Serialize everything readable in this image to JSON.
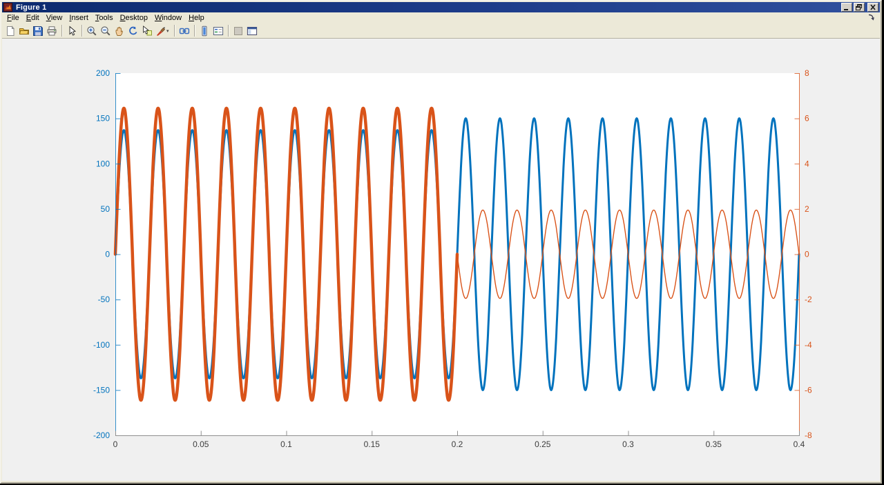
{
  "window": {
    "title": "Figure 1",
    "app_icon": "matlab-logo-icon",
    "controls": [
      {
        "name": "minimize-button",
        "icon": "minimize-icon"
      },
      {
        "name": "restore-button",
        "icon": "restore-icon"
      },
      {
        "name": "close-button",
        "icon": "close-icon"
      }
    ]
  },
  "menu_bar": {
    "items": [
      {
        "label": "File",
        "accelerator": "F"
      },
      {
        "label": "Edit",
        "accelerator": "E"
      },
      {
        "label": "View",
        "accelerator": "V"
      },
      {
        "label": "Insert",
        "accelerator": "I"
      },
      {
        "label": "Tools",
        "accelerator": "T"
      },
      {
        "label": "Desktop",
        "accelerator": "D"
      },
      {
        "label": "Window",
        "accelerator": "W"
      },
      {
        "label": "Help",
        "accelerator": "H"
      }
    ],
    "dock_arrow_icon": "dock-figure-arrow-icon"
  },
  "toolbar": {
    "buttons": [
      {
        "name": "new-figure-button",
        "icon": "new-document-icon",
        "group": 1
      },
      {
        "name": "open-file-button",
        "icon": "open-folder-icon",
        "group": 1
      },
      {
        "name": "save-figure-button",
        "icon": "save-icon",
        "group": 1
      },
      {
        "name": "print-figure-button",
        "icon": "print-icon",
        "group": 1
      },
      {
        "name": "edit-plot-button",
        "icon": "pointer-arrow-icon",
        "group": 2
      },
      {
        "name": "zoom-in-button",
        "icon": "zoom-in-icon",
        "group": 3
      },
      {
        "name": "zoom-out-button",
        "icon": "zoom-out-icon",
        "group": 3
      },
      {
        "name": "pan-button",
        "icon": "pan-hand-icon",
        "group": 3
      },
      {
        "name": "rotate-3d-button",
        "icon": "rotate-3d-icon",
        "group": 3
      },
      {
        "name": "data-cursor-button",
        "icon": "data-cursor-icon",
        "group": 3
      },
      {
        "name": "brush-data-button",
        "icon": "brush-icon",
        "group": 3,
        "has_dropdown": true
      },
      {
        "name": "link-plot-button",
        "icon": "link-plot-icon",
        "group": 4
      },
      {
        "name": "insert-colorbar-button",
        "icon": "colorbar-icon",
        "group": 5
      },
      {
        "name": "insert-legend-button",
        "icon": "legend-icon",
        "group": 5
      },
      {
        "name": "hide-plot-tools-button",
        "icon": "hide-plot-tools-icon",
        "group": 6
      },
      {
        "name": "show-plot-tools-button",
        "icon": "show-plot-tools-dock-icon",
        "group": 6
      }
    ]
  },
  "figure": {
    "background_color": "#f0f0f0"
  },
  "chart_data": {
    "type": "line",
    "title": "",
    "grid": false,
    "legend": null,
    "transition_time_s": 0.2,
    "x": {
      "label": "",
      "range": [
        0,
        0.4
      ],
      "ticks": [
        0,
        0.05,
        0.1,
        0.15,
        0.2,
        0.25,
        0.3,
        0.35,
        0.4
      ],
      "line_color": "#8f8f8f",
      "tick_label_color": "#3c3c3c"
    },
    "left_axis": {
      "range": [
        -200,
        200
      ],
      "ticks": [
        200,
        150,
        100,
        50,
        0,
        -50,
        -100,
        -150,
        -200
      ],
      "color": "#0072BD"
    },
    "right_axis": {
      "range": [
        -8,
        8
      ],
      "ticks": [
        8,
        6,
        4,
        2,
        0,
        -2,
        -4,
        -6,
        -8
      ],
      "color": "#D95319"
    },
    "series": [
      {
        "name": "blue-wave",
        "axis": "left",
        "color": "#0072BD",
        "waveform": "sine",
        "frequency_hz": 50,
        "segments": [
          {
            "t_start": 0.0,
            "t_end": 0.2,
            "amplitude": 137,
            "phase_deg": 0,
            "line_width": 3.0
          },
          {
            "t_start": 0.2,
            "t_end": 0.4,
            "amplitude": 150,
            "phase_deg": 0,
            "line_width": 3.0
          }
        ]
      },
      {
        "name": "orange-wave",
        "axis": "right",
        "color": "#D95319",
        "waveform": "sine",
        "frequency_hz": 50,
        "segments": [
          {
            "t_start": 0.0,
            "t_end": 0.2,
            "amplitude": 6.45,
            "phase_deg": 0,
            "line_width": 4.5
          },
          {
            "t_start": 0.2,
            "t_end": 0.4,
            "amplitude": 1.95,
            "phase_deg": 180,
            "line_width": 1.4
          }
        ]
      }
    ]
  }
}
